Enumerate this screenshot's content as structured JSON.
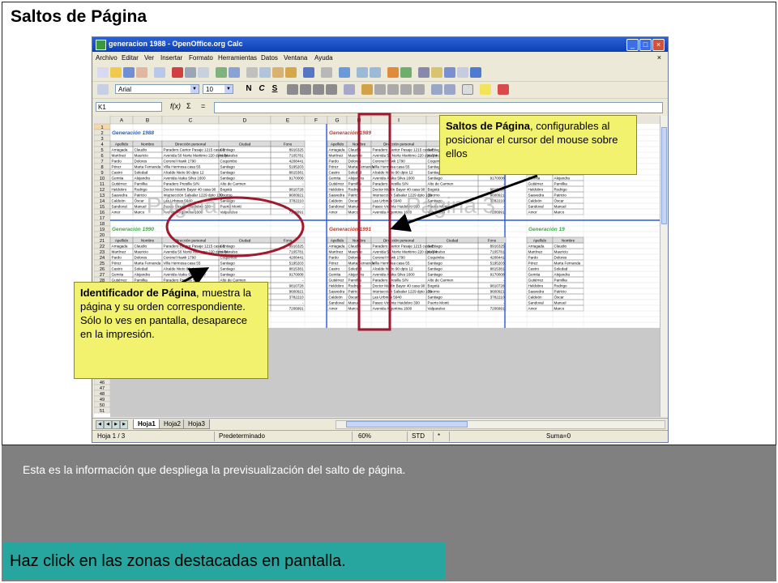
{
  "slide": {
    "title": "Saltos de Página",
    "info_text": "Esta es la información que despliega la previsualización del salto de página.",
    "cta": "Haz click en las zonas destacadas en pantalla."
  },
  "window": {
    "title": "generacion 1988 - OpenOffice.org Calc",
    "buttons": {
      "minimize": "_",
      "maximize": "□",
      "close": "×"
    },
    "close_doc": "×"
  },
  "menu": [
    "Archivo",
    "Editar",
    "Ver",
    "Insertar",
    "Formato",
    "Herramientas",
    "Datos",
    "Ventana",
    "Ayuda"
  ],
  "format_bar": {
    "font": "Arial",
    "size": "10",
    "bold": "N",
    "italic": "C",
    "underline": "S"
  },
  "formula_bar": {
    "cell_ref": "K1",
    "fx": "f(x)",
    "sum": "Σ",
    "equals": "="
  },
  "grid": {
    "columns": [
      "A",
      "B",
      "C",
      "D",
      "E",
      "F",
      "G",
      "H",
      "I",
      "J",
      "K",
      "L",
      "M",
      "N"
    ],
    "row_numbers": [
      "1",
      "2",
      "3",
      "4",
      "5",
      "6",
      "7",
      "8",
      "9",
      "10",
      "11",
      "12",
      "13",
      "14",
      "15",
      "16",
      "17",
      "18",
      "19",
      "20",
      "21",
      "22",
      "23",
      "24",
      "25",
      "26",
      "27",
      "28",
      "29",
      "30",
      "31",
      "32",
      "33",
      "34",
      "35",
      "36",
      "37",
      "38",
      "39",
      "40",
      "41",
      "42",
      "43",
      "44",
      "45",
      "46",
      "47",
      "48",
      "49",
      "50",
      "51"
    ],
    "block_titles": [
      "Generación 1988",
      "Generación 1989",
      "Generación 19",
      "Generación 1990",
      "Generación 1991",
      "Generación 19"
    ],
    "page_watermarks": [
      "Página 1",
      "Página 3"
    ],
    "headers": [
      "Apellido",
      "Nombre",
      "Dirección personal",
      "Ciudad",
      "Fono"
    ],
    "rows": [
      [
        "Arriagada",
        "Claudio",
        "Paradero Cantor Pasaje 1215 casa E",
        "Santiago",
        "8916325"
      ],
      [
        "Martínez",
        "Mauricio",
        "Avenida 50 Norte Maritimo 220 dpto 74",
        "Valparaíso",
        "7105781"
      ],
      [
        "Pardo",
        "Dolores",
        "Coronel Hawk 1790",
        "Coquimbo",
        "4208441"
      ],
      [
        "Pérez",
        "Marta Fernanda",
        "Villa Hermosa casa 55",
        "Santiago",
        "5195203"
      ],
      [
        "Castro",
        "Soledad",
        "Alcalde Nieto 90 dpto 12",
        "Santiago",
        "8815381"
      ],
      [
        "Gemita",
        "Alejandra",
        "Avenida Ataka Silva 1600",
        "Santiago",
        "9170008"
      ],
      [
        "Gutiérrez",
        "Pamilka",
        "Paradero Presilla S/N",
        "Alto de Carmen",
        "-"
      ],
      [
        "Heldobro",
        "Rodrigo",
        "Doctor Martín Bayer 40 casa 90",
        "Bogotá",
        "9810728"
      ],
      [
        "Saavedra",
        "Patricio",
        "Intersección Salsalar 1229 dpto 139",
        "Osorno",
        "9600921"
      ],
      [
        "Caldeón",
        "Óscar",
        "Las Urbinas 5940",
        "Santiago",
        "3782210"
      ],
      [
        "Sandoval",
        "Manuel",
        "Paseo Vicente Huidobro 330",
        "Puerto Montt",
        "-"
      ],
      [
        "Amor",
        "Marco",
        "Avenida Argentina 1600",
        "Valparaíso",
        "7206991"
      ]
    ]
  },
  "sheets": [
    "Hoja1",
    "Hoja2",
    "Hoja3"
  ],
  "status_bar": {
    "sheet": "Hoja 1 / 3",
    "style": "Predeterminado",
    "zoom": "60%",
    "mode": "STD",
    "modified": "*",
    "sum": "Suma=0"
  },
  "callouts": {
    "saltos_title": "Saltos de Página",
    "saltos_body": ", configurables al posicionar el cursor del mouse sobre ellos",
    "ident_title": "Identificador de Página",
    "ident_body": ", muestra la página y su orden correspondiente. Sólo lo ves en pantalla, desaparece en la impresión."
  },
  "colors": {
    "callout_bg": "#f2f26f",
    "highlight_red": "#a0192e",
    "cta_bg": "#26a69e",
    "bottom_panel": "#808080",
    "title_blue": "#1b5fd1"
  }
}
